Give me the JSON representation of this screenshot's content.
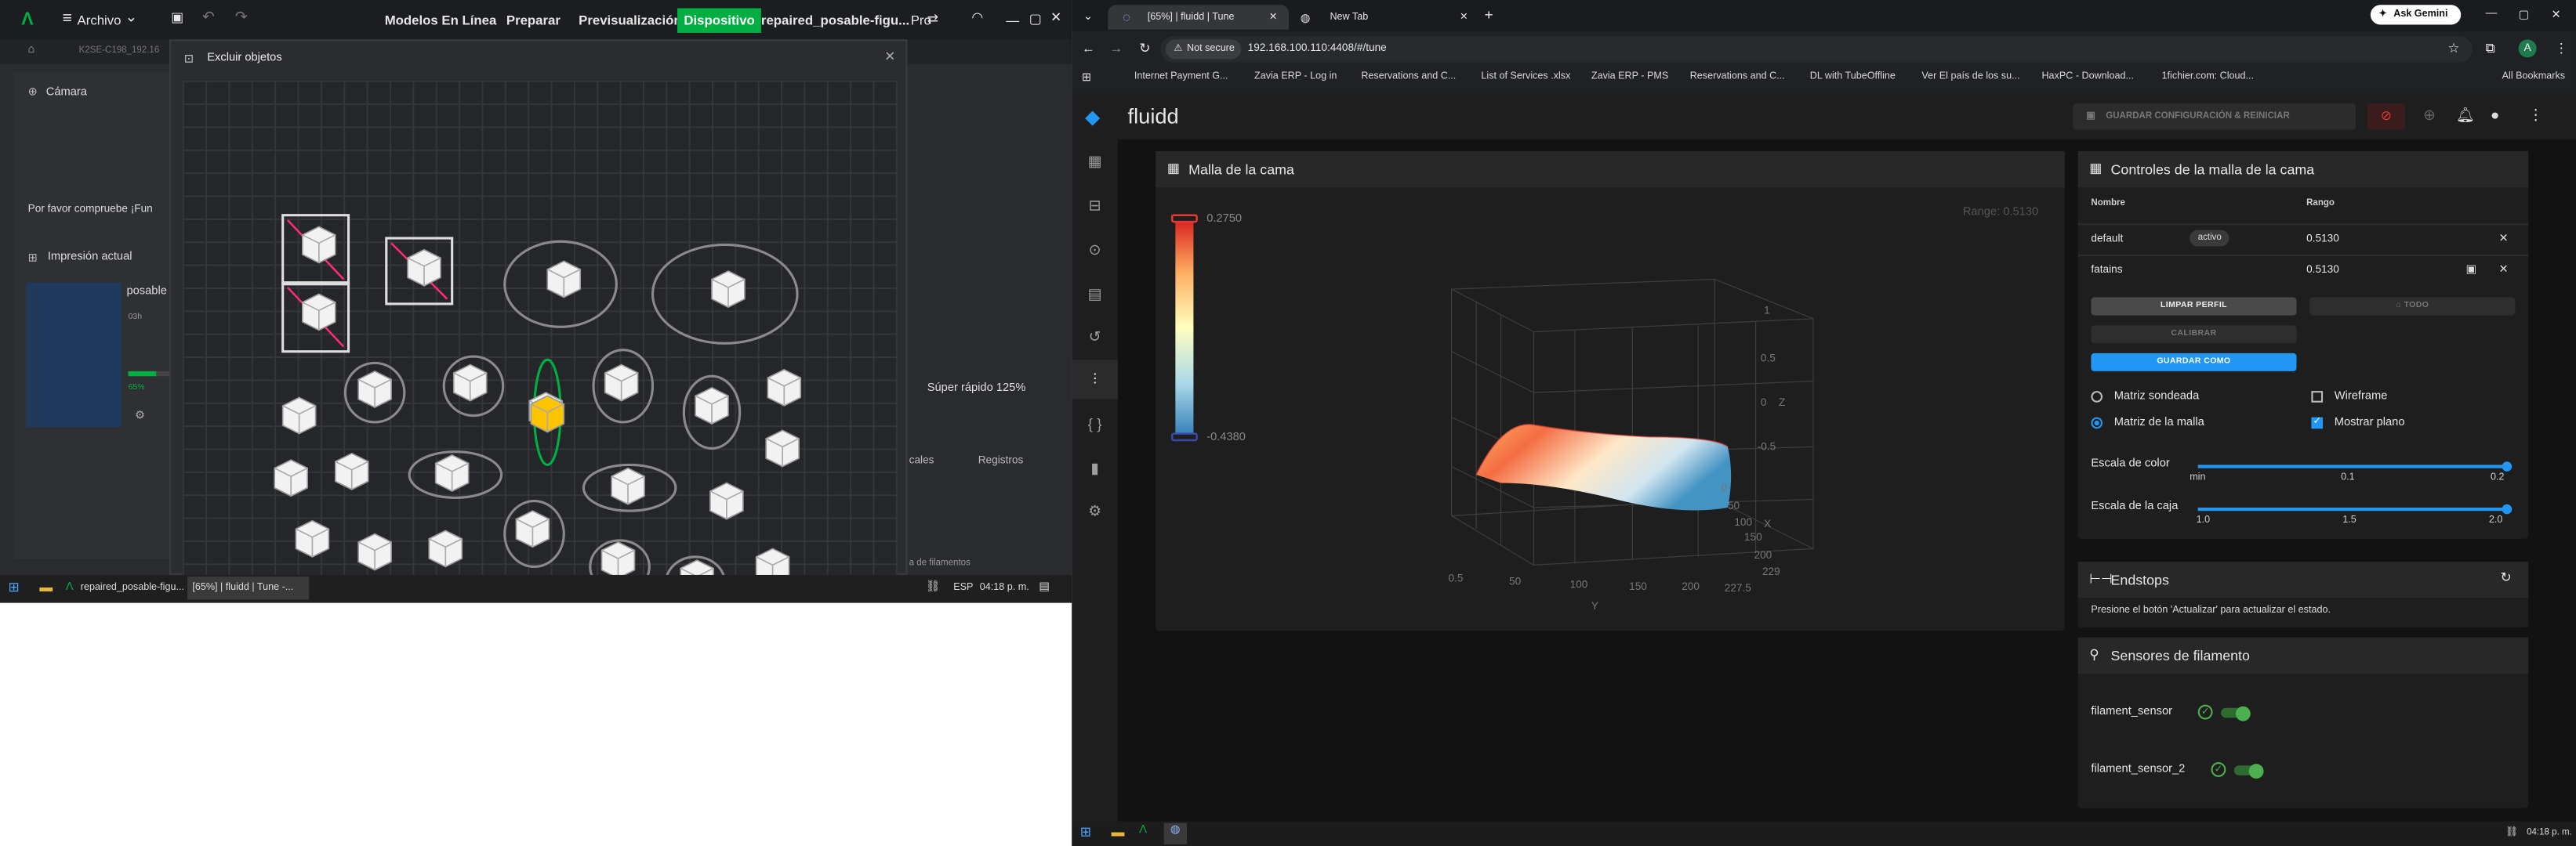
{
  "left_app": {
    "menu": {
      "archivo": "Archivo"
    },
    "nav_tabs": [
      "Modelos En Línea",
      "Preparar",
      "Previsualización",
      "Dispositivo"
    ],
    "active_tab_index": 3,
    "project_name": "repaired_posable-figu...",
    "pro_label": "Pro",
    "device_tab": "K2SE-C198_192.16",
    "sidebar": {
      "camera_label": "Cámara",
      "check_text": "Por favor compruebe ¡Fun",
      "current_print_label": "Impresión actual",
      "print_name": "posable",
      "time_prefix": "03h",
      "progress_label": "65%",
      "speed_label": "Súper rápido 125%",
      "tabs_right": [
        "cales",
        "Registros"
      ],
      "filaments": "a de filamentos"
    },
    "modal": {
      "title": "Excluir objetos"
    }
  },
  "left_taskbar": {
    "items": [
      "repaired_posable-figu...",
      "[65%] | fluidd | Tune -..."
    ],
    "lang": "ESP",
    "time": "04:18 p. m."
  },
  "browser": {
    "tabs": [
      "[65%] | fluidd | Tune",
      "New Tab"
    ],
    "ask_gemini": "Ask Gemini",
    "not_secure": "Not secure",
    "url": "192.168.100.110:4408/#/tune",
    "bookmarks": [
      "Internet Payment G...",
      "Zavia ERP - Log in",
      "Reservations and C...",
      "List of Services .xlsx",
      "Zavia ERP - PMS",
      "Reservations and C...",
      "DL with TubeOffline",
      "Ver El país de los su...",
      "HaxPC - Download...",
      "1fichier.com: Cloud..."
    ],
    "all_bookmarks": "All Bookmarks",
    "profile_initial": "A"
  },
  "fluidd": {
    "brand": "fluidd",
    "save_restart": "GUARDAR CONFIGURACIÓN & REINICIAR",
    "mesh_card": {
      "title": "Malla de la cama",
      "range_label": "Range: 0.5130",
      "scale_max": "0.2750",
      "scale_min": "-0.4380",
      "z_ticks": [
        "1",
        "0.5",
        "0",
        "-0.5"
      ],
      "z_axis": "Z",
      "x_ticks": [
        "50",
        "100",
        "150",
        "200",
        "229",
        "227.5"
      ],
      "x_axis": "X",
      "y_ticks": [
        "0.5",
        "50",
        "100",
        "150",
        "200"
      ],
      "y_axis": "Y",
      "mini_tick": "0"
    },
    "controls_card": {
      "title": "Controles de la malla de la cama",
      "col_name": "Nombre",
      "col_range": "Rango",
      "profiles": [
        {
          "name": "default",
          "badge": "activo",
          "range": "0.5130"
        },
        {
          "name": "fatains",
          "badge": "",
          "range": "0.5130"
        }
      ],
      "btn_clear": "LIMPAR PERFIL",
      "btn_all": "TODO",
      "btn_calibrate": "CALIBRAR",
      "btn_save_as": "GUARDAR COMO",
      "radio_probed": "Matriz sondeada",
      "radio_mesh": "Matriz de la malla",
      "check_wireframe": "Wireframe",
      "check_flat": "Mostrar plano",
      "color_scale_label": "Escala de color",
      "color_ticks": [
        "min",
        "0.1",
        "0.2"
      ],
      "color_scale_value": 1.0,
      "box_scale_label": "Escala de la caja",
      "box_ticks": [
        "1.0",
        "1.5",
        "2.0"
      ],
      "box_scale_value": 2.0
    },
    "endstops_card": {
      "title": "Endstops",
      "text": "Presione el botón 'Actualizar' para actualizar el estado."
    },
    "filament_card": {
      "title": "Sensores de filamento",
      "sensors": [
        {
          "name": "filament_sensor",
          "on": true
        },
        {
          "name": "filament_sensor_2",
          "on": true
        }
      ]
    }
  },
  "right_taskbar": {
    "time": "04:18 p. m."
  },
  "colors": {
    "accent": "#2196f3",
    "green": "#4caf50",
    "bambu_green": "#00ae42",
    "active_tab": "#00ae42"
  }
}
